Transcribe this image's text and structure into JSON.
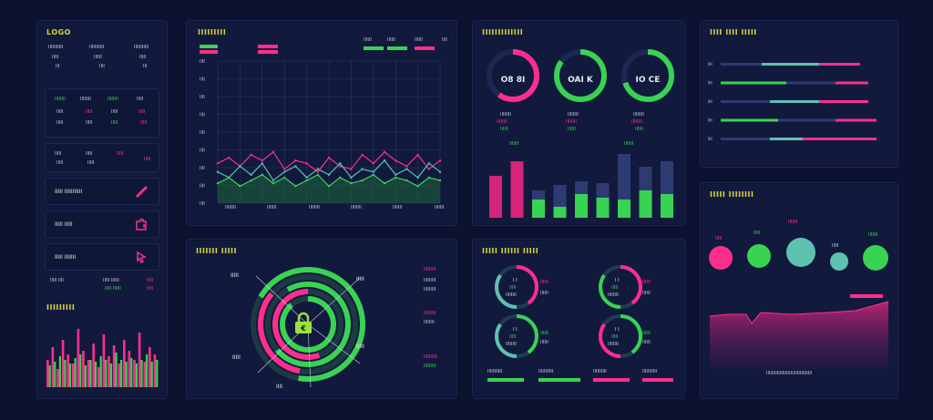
{
  "colors": {
    "background": "#0c1230",
    "panel": "#111a3c",
    "accent_yellow": "#d9d23a",
    "green": "#39d353",
    "pink": "#ff2e8e",
    "teal": "#5fc1b0",
    "slate": "#2e3b73"
  },
  "left_panel": {
    "title": "LOGO",
    "header_cols": [
      [
        "IIIIIIIIIII",
        "IIIII",
        "III"
      ],
      [
        "IIIIIIIIIII",
        "IIIIII",
        "IIII"
      ],
      [
        "IIIIIIIIIII",
        "IIIII",
        "III"
      ]
    ],
    "rows": [
      {
        "label": "IIIIIIII",
        "badge": "IIIII"
      },
      {
        "label": "IIIIIIII",
        "badge": "IIIII"
      },
      {
        "label": "IIIIIIII",
        "badge": "IIIII"
      }
    ],
    "cards": [
      {
        "label": "IIIII IIIIIIIIIII",
        "icon": "paint-brush-icon"
      },
      {
        "label": "IIIII IIIII",
        "icon": "puzzle-icon"
      },
      {
        "label": "IIIII IIIIIII",
        "icon": "pointer-icon"
      }
    ],
    "footer_cols": [
      "IIIII IIII",
      "IIIII IIIIII",
      "IIIII"
    ],
    "chart_title": "IIIIIIIII"
  },
  "line_chart": {
    "title": "IIIIIIIII",
    "legend": [
      "IIIIII",
      "IIIIII",
      "IIIIII",
      "IIII",
      "IIII"
    ],
    "x_labels": [
      "IIIIIIII",
      "IIIIIII",
      "IIIIIIII",
      "IIIIIIII",
      "IIIIIII",
      "IIIIIII"
    ],
    "y_labels": [
      "IIII",
      "IIII",
      "IIII",
      "IIII",
      "IIII",
      "IIII",
      "IIII",
      "IIII",
      "IIII"
    ]
  },
  "gauges_panel": {
    "title": "IIIIIIIIIIIII",
    "gauges": [
      {
        "label": "O8 8I",
        "line1": "IIIIIIII",
        "line2": "IIIIIIII",
        "line3": "IIIIII",
        "value": 0.6,
        "color": "#ff2e8e"
      },
      {
        "label": "OAI K",
        "line1": "IIIIIIII",
        "line2": "IIIIIIII",
        "line3": "IIIIII",
        "value": 0.85,
        "color": "#39d353"
      },
      {
        "label": "IO CE",
        "line1": "IIIIIIII",
        "line2": "IIIIIIII",
        "line3": "IIIIII",
        "value": 0.7,
        "color": "#39d353"
      }
    ],
    "bar_labels": [
      "IIIIIII",
      "IIIIIII",
      "IIIIIII"
    ]
  },
  "hbar_panel": {
    "title": "IIII IIII IIIII",
    "bars": [
      {
        "label": "IIII",
        "segments": [
          0.25,
          0.35,
          0.25
        ]
      },
      {
        "label": "IIII",
        "segments": [
          0.4,
          0.3,
          0.2
        ]
      },
      {
        "label": "IIII",
        "segments": [
          0.3,
          0.3,
          0.3
        ]
      },
      {
        "label": "IIII",
        "segments": [
          0.35,
          0.35,
          0.25
        ]
      },
      {
        "label": "IIII",
        "segments": [
          0.3,
          0.2,
          0.45
        ]
      }
    ],
    "axis_labels": [
      "IIII",
      "IIIIIII",
      "IIII",
      "IIII",
      "IIII"
    ]
  },
  "radial_panel": {
    "title": "IIIIIII IIIII",
    "labels": [
      "IIIII",
      "IIIII",
      "IIIII",
      "IIIII",
      "IIII"
    ],
    "legend": [
      "IIIIIIIII",
      "IIIIIIIII",
      "IIIIIIIII",
      "IIIIIIIII",
      "IIIIIIII",
      "IIIIIIIIII"
    ]
  },
  "mini_gauges_panel": {
    "title": "IIIII IIIIII IIIII",
    "gauges": [
      {
        "top": "I I",
        "mid": "IIIII",
        "bot": "IIIIIIII"
      },
      {
        "top": "I I",
        "mid": "IIIII",
        "bot": "IIIIIIII"
      },
      {
        "top": "I I",
        "mid": "IIIII",
        "bot": "IIIIIIII"
      },
      {
        "top": "I I",
        "mid": "IIIII",
        "bot": "IIIIIIII"
      }
    ],
    "side_labels": [
      "IIIIII",
      "IIIIII",
      "IIIIII",
      "IIIIII"
    ],
    "footer": [
      "IIIIIIIIIII",
      "IIIIIIIIIII",
      "IIIIIIIIII",
      "IIIIIIIIIII"
    ]
  },
  "bubble_panel": {
    "title": "IIIII IIIIIIII",
    "labels": [
      "IIIII",
      "IIIII",
      "IIIIIII",
      "IIIII",
      "IIIIIII"
    ],
    "footer": "IIIIIIIIIIIIIIIIIIIIIIIIIIIIIIIIII"
  }
}
